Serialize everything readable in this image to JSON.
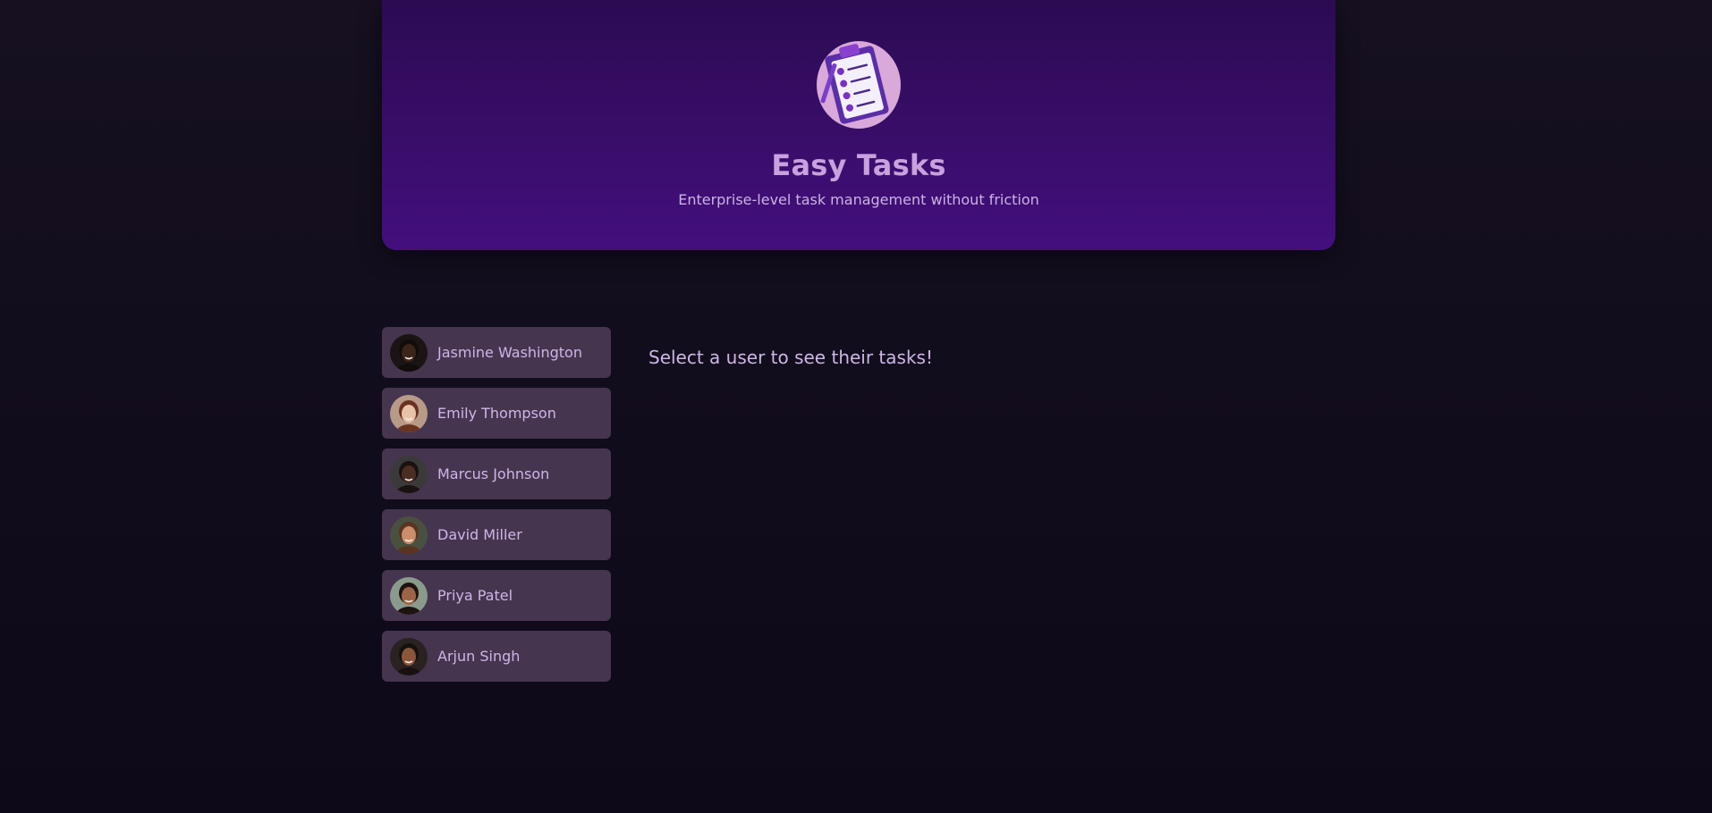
{
  "header": {
    "title": "Easy Tasks",
    "subtitle": "Enterprise-level task management without friction",
    "logo_icon": "clipboard-checklist-icon"
  },
  "users": [
    {
      "name": "Jasmine Washington",
      "skin": "#3b2418",
      "hair": "#120c0a",
      "bg": "#1a1414"
    },
    {
      "name": "Emily Thompson",
      "skin": "#e7c3a8",
      "hair": "#6a3320",
      "bg": "#b79a88"
    },
    {
      "name": "Marcus Johnson",
      "skin": "#4a2e22",
      "hair": "#1a1210",
      "bg": "#3a3a3a"
    },
    {
      "name": "David Miller",
      "skin": "#c98e6a",
      "hair": "#5a3420",
      "bg": "#4a5040"
    },
    {
      "name": "Priya Patel",
      "skin": "#9b6446",
      "hair": "#1d130f",
      "bg": "#8a9a8c"
    },
    {
      "name": "Arjun Singh",
      "skin": "#8a5638",
      "hair": "#161010",
      "bg": "#2a2220"
    }
  ],
  "fallback_text": "Select a user to see their tasks!",
  "colors": {
    "background": "#120d1c",
    "header_top": "#2c0b52",
    "header_bottom": "#430f7d",
    "user_item_bg": "#46354f",
    "text": "#cdb6e6",
    "title": "#c7a2dd"
  }
}
